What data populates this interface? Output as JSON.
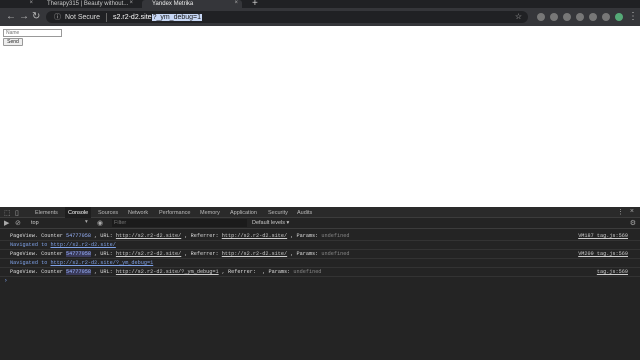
{
  "tabs": [
    {
      "title": ""
    },
    {
      "title": "Therapy315 | Beauty without..."
    },
    {
      "title": "Yandex Metrika"
    }
  ],
  "address": {
    "security_label": "Not Secure",
    "host": "s2.r2-d2.site",
    "query": "?_ym_debug=1"
  },
  "page": {
    "name_placeholder": "Name",
    "send_label": "Send"
  },
  "devtools": {
    "tabs": [
      "Elements",
      "Console",
      "Sources",
      "Network",
      "Performance",
      "Memory",
      "Application",
      "Security",
      "Audits"
    ],
    "active_tab": "Console",
    "context": "top",
    "filter_placeholder": "Filter",
    "levels": "Default levels ▾"
  },
  "console": {
    "rows": [
      {
        "pre": "PageView. Counter",
        "counter": "54777058",
        "mid1": ", URL:",
        "url": "http://s2.r2-d2.site/",
        "mid2": ", Referrer:",
        "ref": "http://s2.r2-d2.site/",
        "mid3": ", Params:",
        "params": "undefined",
        "source": "VM187 tag.js:569"
      },
      {
        "nav": "Navigated to",
        "url": "http://s2.r2-d2.site/"
      },
      {
        "pre": "PageView. Counter",
        "counter": "54777058",
        "mid1": ", URL:",
        "url": "http://s2.r2-d2.site/",
        "mid2": ", Referrer:",
        "ref": "http://s2.r2-d2.site/",
        "mid3": ", Params:",
        "params": "undefined",
        "source": "VM209 tag.js:569"
      },
      {
        "nav": "Navigated to",
        "url": "http://s2.r2-d2.site/?_ym_debug=1"
      },
      {
        "pre": "PageView. Counter",
        "counter": "54777058",
        "mid1": ", URL:",
        "url": "http://s2.r2-d2.site/?_ym_debug=1",
        "mid2": ", Referrer:",
        "ref": "",
        "mid3": ", Params:",
        "params": "undefined",
        "source": "tag.js:569"
      }
    ]
  }
}
